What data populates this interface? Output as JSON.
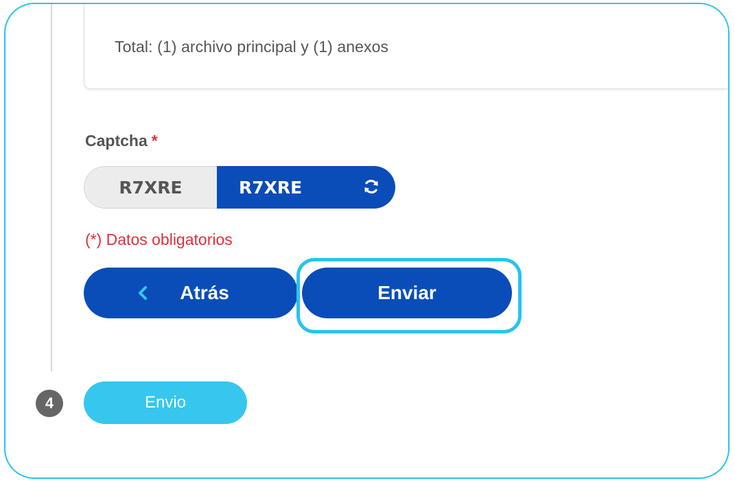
{
  "files": {
    "total_text": "Total: (1) archivo principal y (1) anexos"
  },
  "captcha": {
    "label": "Captcha",
    "required_mark": "*",
    "image_text": "R7XRE",
    "input_value": "R7XRE",
    "refresh_icon": "refresh-icon"
  },
  "required_note": "(*) Datos obligatorios",
  "buttons": {
    "back_label": "Atrás",
    "back_icon": "chevron-left-icon",
    "send_label": "Enviar"
  },
  "step": {
    "number": "4",
    "label": "Envio"
  },
  "colors": {
    "primary": "#0a4db8",
    "accent": "#27c4ec",
    "step_pill": "#36c6ee",
    "error": "#e0303c",
    "text_muted": "#555555"
  }
}
